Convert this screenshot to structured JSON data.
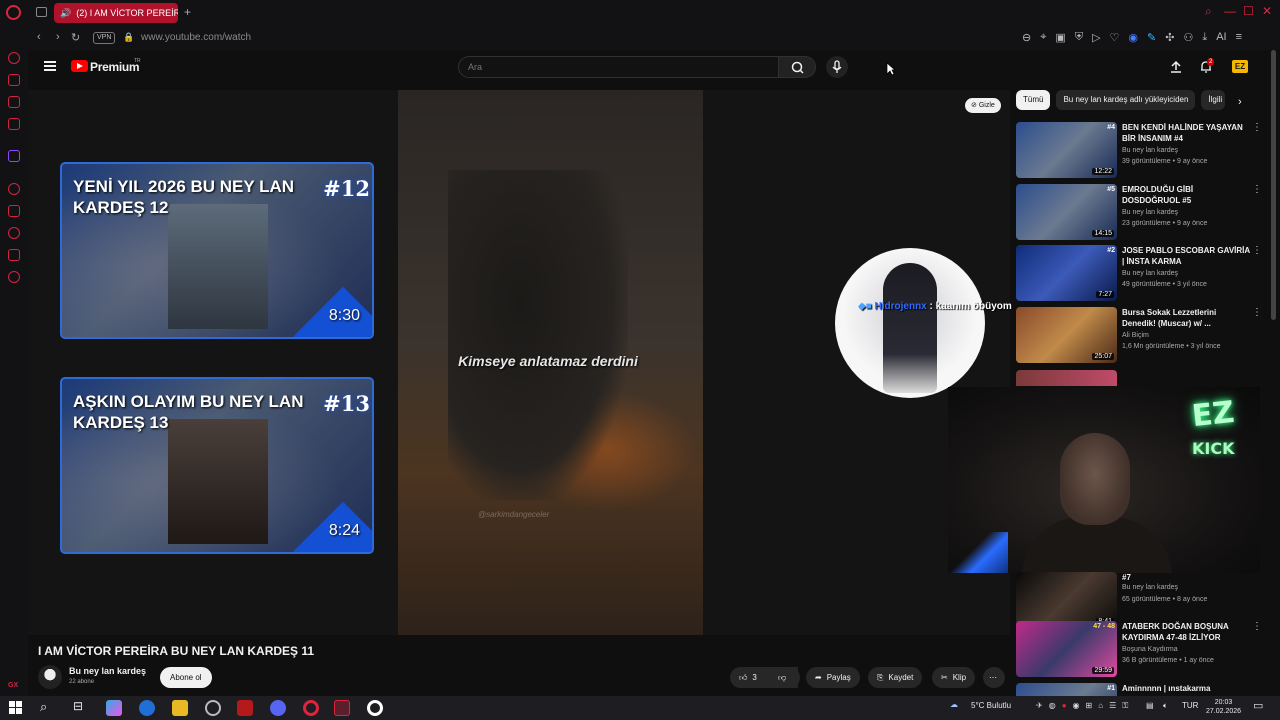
{
  "browser": {
    "tab_title": "(2) I AM VİCTOR PEREİRA",
    "url": "www.youtube.com/watch",
    "vpn_label": "VPN",
    "ai_label": "AI"
  },
  "youtube": {
    "brand": "Premium",
    "brand_sup": "TR",
    "search_placeholder": "Ara",
    "notification_count": "2",
    "hide_label": "Gizle"
  },
  "player": {
    "subtitle": "Kimseye anlatamaz derdini",
    "watermark": "@sarkimdangeceler",
    "end_cards": [
      {
        "title": "YENİ YIL 2026 BU NEY LAN KARDEŞ 12",
        "number": "#12",
        "duration": "8:30"
      },
      {
        "title": "AŞKIN OLAYIM BU NEY LAN KARDEŞ 13",
        "number": "#13",
        "duration": "8:24"
      }
    ],
    "chat": {
      "user": "Hidrojennx",
      "message": ": kaanım öbüyom"
    },
    "cam": {
      "neon_top": "EZ",
      "neon_bottom": "KICK"
    }
  },
  "video": {
    "title": "I AM VİCTOR PEREİRA BU NEY LAN KARDEŞ 11",
    "channel": "Bu ney lan kardeş",
    "subscribers": "22 abone",
    "subscribe_label": "Abone ol",
    "like_count": "3",
    "share_label": "Paylaş",
    "save_label": "Kaydet",
    "clip_label": "Klip"
  },
  "filters": {
    "chips": [
      "Tümü",
      "Bu ney lan kardeş adlı yükleyiciden",
      "İlgili"
    ]
  },
  "recommendations": [
    {
      "title": "BEN KENDİ HALİNDE YAŞAYAN BİR İNSANIM #4",
      "channel": "Bu ney lan kardeş",
      "views": "39 görüntüleme • 9 ay önce",
      "duration": "12:22",
      "tag": "#4"
    },
    {
      "title": "EMROLDUĞU GİBİ DOSDOĞRUOL #5",
      "channel": "Bu ney lan kardeş",
      "views": "23 görüntüleme • 9 ay önce",
      "duration": "14:15",
      "tag": "#5"
    },
    {
      "title": "JOSE PABLO ESCOBAR GAVİRİA | İNSTA KARMA",
      "channel": "Bu ney lan kardeş",
      "views": "49 görüntüleme • 3 yıl önce",
      "duration": "7:27",
      "tag": "#2"
    },
    {
      "title": "Bursa Sokak Lezzetlerini Denedik! (Muscar) w/ ...",
      "channel": "Ali Biçim",
      "views": "1,6 Mn görüntüleme • 3 yıl önce",
      "duration": "25:07",
      "tag": ""
    },
    {
      "title": "#7",
      "channel": "Bu ney lan kardeş",
      "views": "65 görüntüleme • 8 ay önce",
      "duration": "8:41",
      "tag": ""
    },
    {
      "title": "ATABERK DOĞAN BOŞUNA KAYDIRMA 47-48 İZLİYOR",
      "channel": "Boşuna Kaydırma",
      "views": "36 B görüntüleme • 1 ay önce",
      "duration": "29:59",
      "tag": "47 - 48"
    },
    {
      "title": "Aminnnnn | ınstakarma",
      "channel": "",
      "views": "",
      "duration": "",
      "tag": "#1"
    }
  ],
  "taskbar": {
    "weather": "5°C Bulutlu",
    "language": "TUR",
    "time": "20:03",
    "date": "27.02.2026"
  },
  "colors": {
    "accent_red": "#ff0000",
    "opera_red": "#e0233c",
    "endcard_blue": "#2f6bd6"
  }
}
